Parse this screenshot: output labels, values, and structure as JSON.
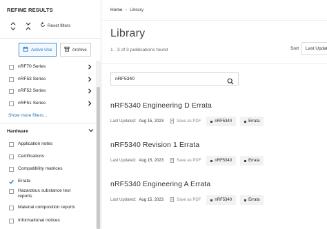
{
  "sidebar": {
    "title": "REFINE RESULTS",
    "reset_label": "Reset filters",
    "tabs": [
      {
        "label": "Active Use",
        "active": true
      },
      {
        "label": "Archive",
        "active": false
      }
    ],
    "series": [
      {
        "label": "nRF70 Series"
      },
      {
        "label": "nRF53 Series"
      },
      {
        "label": "nRF52 Series"
      },
      {
        "label": "nRF51 Series"
      }
    ],
    "show_more": "Show more filters...",
    "hardware": {
      "title": "Hardware",
      "items": [
        {
          "label": "Application notes",
          "checked": false
        },
        {
          "label": "Certifications",
          "checked": false
        },
        {
          "label": "Compatibility matrices",
          "checked": false
        },
        {
          "label": "Errata",
          "checked": true
        },
        {
          "label": "Hazardous substance test reports",
          "checked": false
        },
        {
          "label": "Material composition reports",
          "checked": false
        },
        {
          "label": "Informational notices",
          "checked": false
        }
      ]
    }
  },
  "breadcrumb": {
    "home": "Home",
    "separator": "›",
    "current": "Library"
  },
  "page": {
    "title": "Library",
    "results_count": "1 - 3 of 3 publications found",
    "sort_label": "Sort",
    "sort_value": "Last Updated"
  },
  "search": {
    "value": "nRF5340",
    "placeholder": ""
  },
  "results": [
    {
      "title": "nRF5340 Engineering D Errata",
      "updated_label": "Last Updated:",
      "date": "Aug 15, 2023",
      "save_label": "Save as PDF",
      "tags": [
        "nRF5340",
        "Errata"
      ]
    },
    {
      "title": "nRF5340 Revision 1 Errata",
      "updated_label": "Last Updated:",
      "date": "Aug 15, 2023",
      "save_label": "Save as PDF",
      "tags": [
        "nRF5340",
        "Errata"
      ]
    },
    {
      "title": "nRF5340 Engineering A Errata",
      "updated_label": "Last Updated:",
      "date": "Aug 15, 2023",
      "save_label": "Save as PDF",
      "tags": [
        "nRF5340",
        "Errata"
      ]
    }
  ],
  "colors": {
    "accent": "#1e73be",
    "tag_bg": "#f2f2f2",
    "border": "#e4e4e4"
  }
}
